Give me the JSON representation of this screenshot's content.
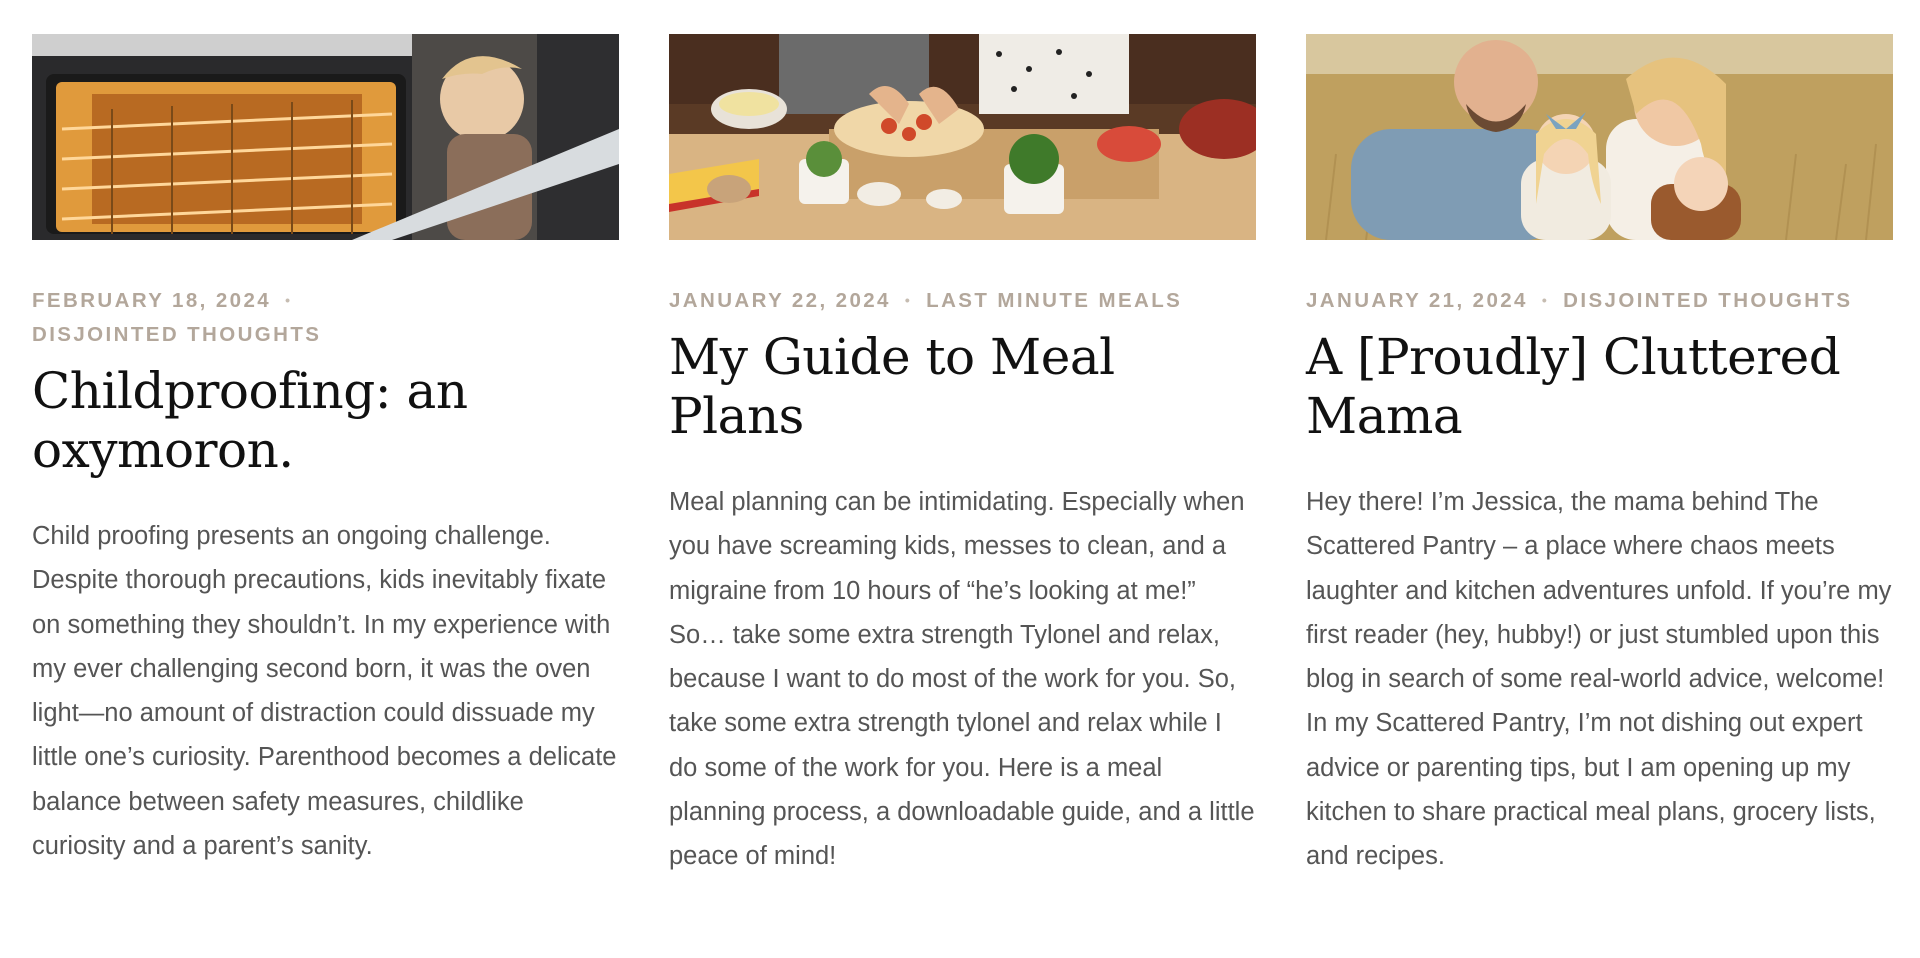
{
  "posts": [
    {
      "image_alt": "Toddler peeking into an open oven",
      "date": "FEBRUARY 18, 2024",
      "category": "DISJOINTED THOUGHTS",
      "title": "Childproofing: an oxymoron.",
      "excerpt": "Child proofing presents an ongoing challenge. Despite thorough precautions, kids inevitably fixate on something they shouldn’t. In my experience with my ever challenging second born, it was the oven light—no amount of distraction could dissuade my little one’s curiosity. Parenthood becomes a delicate balance between safety measures, childlike curiosity and a parent’s sanity."
    },
    {
      "image_alt": "Hands assembling a pizza on a wooden board with ingredients",
      "date": "JANUARY 22, 2024",
      "category": "LAST MINUTE MEALS",
      "title": "My Guide to Meal Plans",
      "excerpt": "Meal planning can be intimidating. Especially when you have screaming kids, messes to clean, and a migraine from 10 hours of “he’s looking at me!” So… take some extra strength Tylonel and relax, because I want to do most of the work for you. So, take some extra strength tylonel and relax while I do some of the work for you. Here is a meal planning process, a downloadable guide, and a little peace of mind!"
    },
    {
      "image_alt": "Family portrait in a golden field",
      "date": "JANUARY 21, 2024",
      "category": "DISJOINTED THOUGHTS",
      "title": "A [Proudly] Cluttered Mama",
      "excerpt": "Hey there! I’m Jessica, the mama behind The Scattered Pantry – a place where chaos meets laughter and kitchen adventures unfold. If you’re my first reader (hey, hubby!) or just stumbled upon this blog in search of some real-world advice, welcome! In my Scattered Pantry, I’m not dishing out expert advice or parenting tips, but I am opening up my kitchen to share practical meal plans, grocery lists, and recipes."
    }
  ],
  "separator": "•",
  "colors": {
    "meta": "#b3a79b",
    "title": "#111111",
    "excerpt": "#555555"
  }
}
